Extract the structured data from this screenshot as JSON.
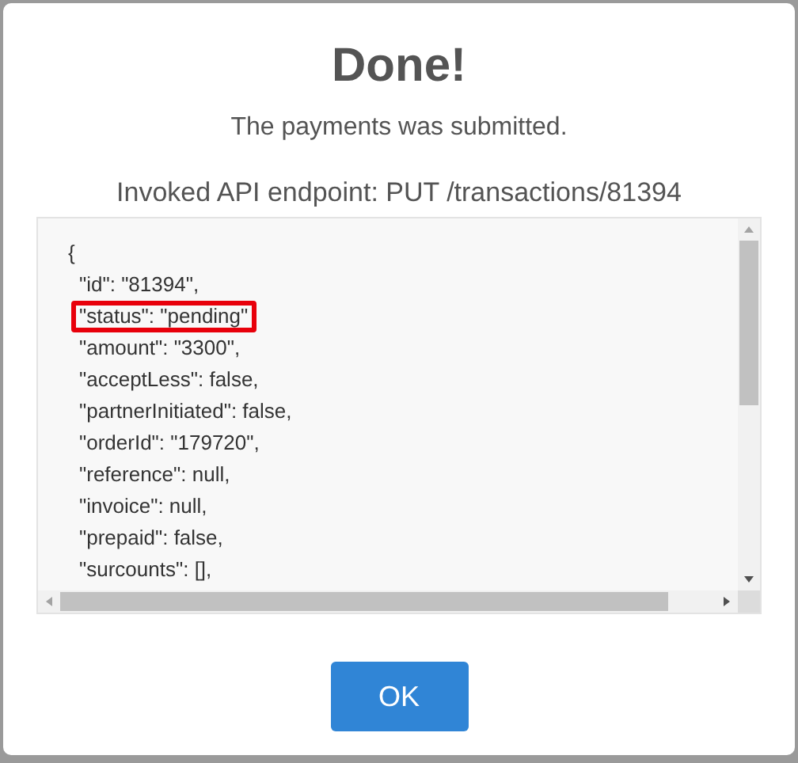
{
  "dialog": {
    "title": "Done!",
    "message": "The payments was submitted.",
    "endpoint": "Invoked API endpoint: PUT /transactions/81394",
    "response": {
      "text": "{",
      "highlighted": false,
      "children": [
        {
          "text": "\"id\": \"81394\",",
          "highlighted": false
        },
        {
          "text": "\"status\": \"pending\"",
          "highlighted": true
        },
        {
          "text": "\"amount\": \"3300\",",
          "highlighted": false
        },
        {
          "text": "\"acceptLess\": false,",
          "highlighted": false
        },
        {
          "text": "\"partnerInitiated\": false,",
          "highlighted": false
        },
        {
          "text": "\"orderId\": \"179720\",",
          "highlighted": false
        },
        {
          "text": "\"reference\": null,",
          "highlighted": false
        },
        {
          "text": "\"invoice\": null,",
          "highlighted": false
        },
        {
          "text": "\"prepaid\": false,",
          "highlighted": false
        },
        {
          "text": "\"surcounts\": [],",
          "highlighted": false
        }
      ]
    },
    "buttons": [
      {
        "label": "OK"
      }
    ]
  }
}
